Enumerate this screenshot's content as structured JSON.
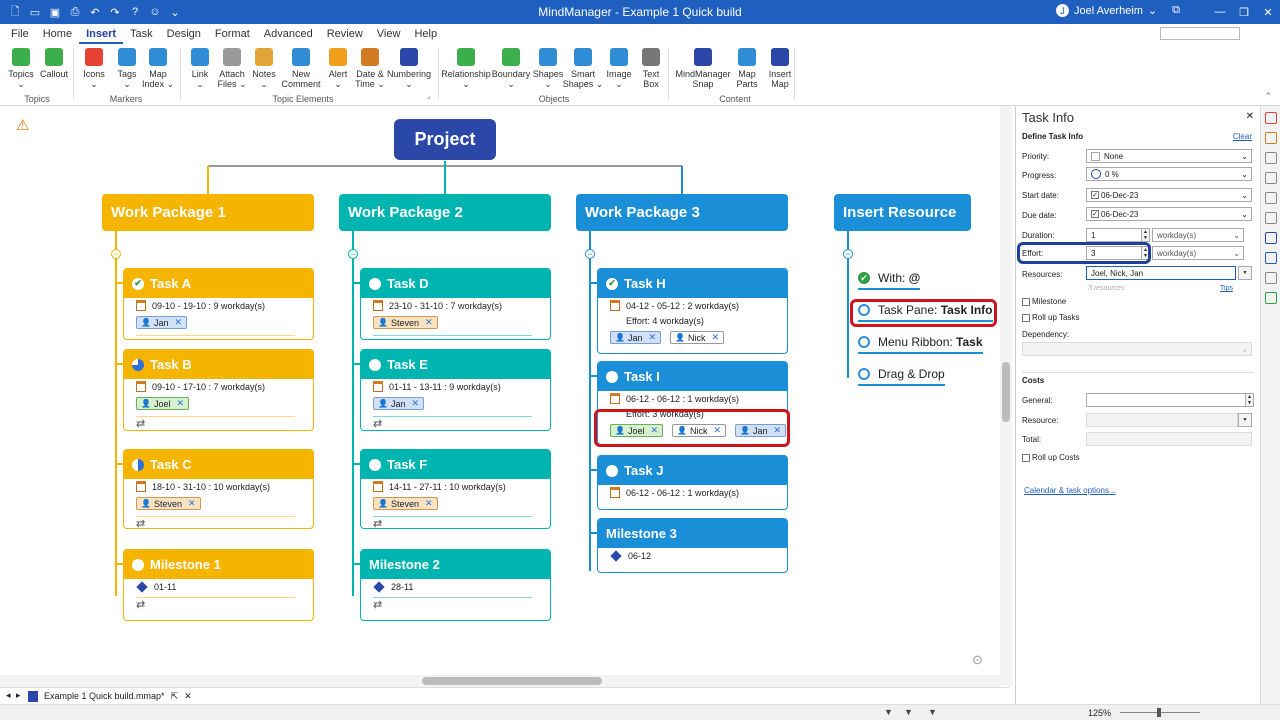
{
  "window": {
    "title": "MindManager - Example 1 Quick build",
    "user": "Joel Averheim",
    "user_chevron": "⌄",
    "avatar_text": "J",
    "min": "—",
    "max": "❐",
    "close": "✕",
    "restore_ribbon": "⧉",
    "qat_icons": [
      "new-icon",
      "open-icon",
      "save-icon",
      "print-icon",
      "undo-icon",
      "redo-icon",
      "help-icon",
      "feedback-icon",
      "customize-icon"
    ],
    "qat_glyphs": [
      "🗋",
      "▭",
      "▣",
      "⎙",
      "↶",
      "↷",
      "?",
      "☺",
      "⌄"
    ]
  },
  "menu": {
    "tabs": [
      "File",
      "Home",
      "Insert",
      "Task",
      "Design",
      "Format",
      "Advanced",
      "Review",
      "View",
      "Help"
    ],
    "active": "Insert"
  },
  "ribbon": {
    "buttons": [
      {
        "label": "Topics",
        "sub": "⌄",
        "icon": "topics-icon",
        "color": "#3caf4c"
      },
      {
        "label": "Callout",
        "sub": "",
        "icon": "callout-icon",
        "color": "#3caf4c"
      },
      {
        "label": "Icons",
        "sub": "⌄",
        "icon": "icons-icon",
        "color": "#e34234"
      },
      {
        "label": "Tags",
        "sub": "⌄",
        "icon": "tags-icon",
        "color": "#2f8cd5"
      },
      {
        "label": "Map",
        "sub": "Index ⌄",
        "icon": "map-index-icon",
        "color": "#2f8cd5"
      },
      {
        "label": "Link",
        "sub": "⌄",
        "icon": "link-icon",
        "color": "#2f8cd5"
      },
      {
        "label": "Attach",
        "sub": "Files ⌄",
        "icon": "attach-icon",
        "color": "#999999"
      },
      {
        "label": "Notes",
        "sub": "⌄",
        "icon": "notes-icon",
        "color": "#e4a43a"
      },
      {
        "label": "New",
        "sub": "Comment",
        "icon": "comment-icon",
        "color": "#2f8cd5"
      },
      {
        "label": "Alert",
        "sub": "⌄",
        "icon": "alert-icon",
        "color": "#f0a01c"
      },
      {
        "label": "Date &",
        "sub": "Time ⌄",
        "icon": "calendar-icon",
        "color": "#d27b22"
      },
      {
        "label": "Numbering",
        "sub": "⌄",
        "icon": "numbering-icon",
        "color": "#2b47a8"
      },
      {
        "label": "Relationship",
        "sub": "⌄",
        "icon": "relationship-icon",
        "color": "#3caf4c"
      },
      {
        "label": "Boundary",
        "sub": "⌄",
        "icon": "boundary-icon",
        "color": "#3caf4c"
      },
      {
        "label": "Shapes",
        "sub": "⌄",
        "icon": "shapes-icon",
        "color": "#2f8cd5"
      },
      {
        "label": "Smart",
        "sub": "Shapes ⌄",
        "icon": "smart-shapes-icon",
        "color": "#2f8cd5"
      },
      {
        "label": "Image",
        "sub": "⌄",
        "icon": "image-icon",
        "color": "#2f8cd5"
      },
      {
        "label": "Text",
        "sub": "Box",
        "icon": "textbox-icon",
        "color": "#777777"
      },
      {
        "label": "MindManager",
        "sub": "Snap",
        "icon": "snap-icon",
        "color": "#2b47a8"
      },
      {
        "label": "Map",
        "sub": "Parts",
        "icon": "map-parts-icon",
        "color": "#2f8cd5"
      },
      {
        "label": "Insert",
        "sub": "Map",
        "icon": "insert-map-icon",
        "color": "#2b47a8"
      }
    ],
    "groups": [
      "Topics",
      "Markers",
      "Topic Elements",
      "Objects",
      "Content"
    ],
    "launcher": "⌟",
    "collapse": "⌃"
  },
  "map": {
    "root": "Project",
    "alert_icon": "⚠",
    "collapse_glyph": "−",
    "check_glyph": "✔",
    "diamond_icon": "milestone-diamond-icon",
    "calendar_icon": "calendar-icon",
    "link_glyph": "⇄",
    "remove_glyph": "✕",
    "person_glyph": "👤",
    "colors": {
      "wp1": "#f5b400",
      "wp2": "#00b5b0",
      "wp3": "#1a8fd8",
      "insert": "#1a8fd8",
      "root": "#2b47a8",
      "red": "#d0141c"
    },
    "work_packages": [
      {
        "title": "Work Package 1",
        "tasks": [
          {
            "name": "Task A",
            "status": "done",
            "lines": [
              "09-10 - 19-10 : 9 workday(s)"
            ],
            "resources": [
              "Jan"
            ],
            "link": "⇄"
          },
          {
            "name": "Task B",
            "status": "progress",
            "lines": [
              "09-10 - 17-10 : 7 workday(s)"
            ],
            "resources": [
              "Joel"
            ],
            "link": "⇄"
          },
          {
            "name": "Task C",
            "status": "half",
            "lines": [
              "18-10 - 31-10 : 10 workday(s)"
            ],
            "resources": [
              "Steven"
            ],
            "link": "⇄"
          },
          {
            "name": "Milestone 1",
            "status": "open",
            "lines": [
              "01-11"
            ],
            "resources": [],
            "link": "⇄"
          }
        ]
      },
      {
        "title": "Work Package 2",
        "tasks": [
          {
            "name": "Task D",
            "status": "open",
            "lines": [
              "23-10 - 31-10 : 7 workday(s)"
            ],
            "resources": [
              "Steven"
            ],
            "link": "⇄"
          },
          {
            "name": "Task E",
            "status": "open",
            "lines": [
              "01-11 - 13-11 : 9 workday(s)"
            ],
            "resources": [
              "Jan"
            ],
            "link": "⇄"
          },
          {
            "name": "Task F",
            "status": "open",
            "lines": [
              "14-11 - 27-11 : 10 workday(s)"
            ],
            "resources": [
              "Steven"
            ],
            "link": "⇄"
          },
          {
            "name": "Milestone 2",
            "status": "none",
            "lines": [
              "28-11"
            ],
            "resources": [],
            "link": "⇄"
          }
        ]
      },
      {
        "title": "Work Package 3",
        "tasks": [
          {
            "name": "Task H",
            "status": "done",
            "lines": [
              "04-12 - 05-12 : 2 workday(s)",
              "Effort: 4 workday(s)"
            ],
            "resources": [
              "Jan",
              "Nick"
            ],
            "link": ""
          },
          {
            "name": "Task I",
            "status": "open",
            "lines": [
              "06-12 - 06-12 : 1 workday(s)",
              "Effort: 3 workday(s)"
            ],
            "resources": [
              "Joel",
              "Nick",
              "Jan"
            ],
            "link": ""
          },
          {
            "name": "Task J",
            "status": "open",
            "lines": [
              "06-12 - 06-12 : 1 workday(s)"
            ],
            "resources": [],
            "link": ""
          },
          {
            "name": "Milestone 3",
            "status": "none",
            "lines": [
              "06-12"
            ],
            "resources": [],
            "link": ""
          }
        ]
      }
    ],
    "insert_resource": {
      "title": "Insert Resource",
      "items": [
        {
          "prefix": "With: ",
          "bold": "@",
          "status": "done"
        },
        {
          "prefix": "Task Pane: ",
          "bold": "Task Info",
          "status": "open"
        },
        {
          "prefix": "Menu Ribbon: ",
          "bold": "Task",
          "status": "open"
        },
        {
          "prefix": "Drag & Drop",
          "bold": "",
          "status": "open"
        }
      ]
    },
    "location_icon": "⊙"
  },
  "doc_tab": {
    "icon": "mmap-file-icon",
    "name": "Example 1 Quick build.mmap*",
    "pin": "⇱",
    "close": "✕",
    "nav_left": "◂",
    "nav_right": "▸"
  },
  "task_pane": {
    "title": "Task Info",
    "close": "✕",
    "section": "Define Task Info",
    "clear": "Clear",
    "priority_label": "Priority:",
    "priority": "None",
    "progress_label": "Progress:",
    "progress": "0 %",
    "start_label": "Start date:",
    "start": "06-Dec-23",
    "due_label": "Due date:",
    "due": "06-Dec-23",
    "duration_label": "Duration:",
    "duration": "1",
    "duration_unit": "workday(s)",
    "effort_label": "Effort:",
    "effort": "3",
    "effort_unit": "workday(s)",
    "resources_label": "Resources:",
    "resources": "Joel, Nick, Jan",
    "resources_count": "3 resources",
    "tips": "Tips",
    "milestone": "Milestone",
    "rollup": "Roll up Tasks",
    "dependency": "Dependency:",
    "costs": "Costs",
    "general": "General:",
    "resource": "Resource:",
    "total": "Total:",
    "rollup_costs": "Roll up Costs",
    "calendar_link": "Calendar & task options...",
    "dropdown_glyph": "⌄",
    "check_glyph": "✓",
    "spin_up": "▲",
    "spin_down": "▼"
  },
  "sidebar_icons": [
    "task-info-icon",
    "calendar-icon",
    "resources-icon",
    "map-parts-icon",
    "library-icon",
    "search-icon",
    "task-icon",
    "outlook-icon",
    "browser-icon",
    "excel-icon"
  ],
  "status": {
    "zoom": "125%",
    "icons": [
      "filter-icon",
      "show-hide-icon",
      "fit-icon",
      "zoom-icon"
    ]
  }
}
